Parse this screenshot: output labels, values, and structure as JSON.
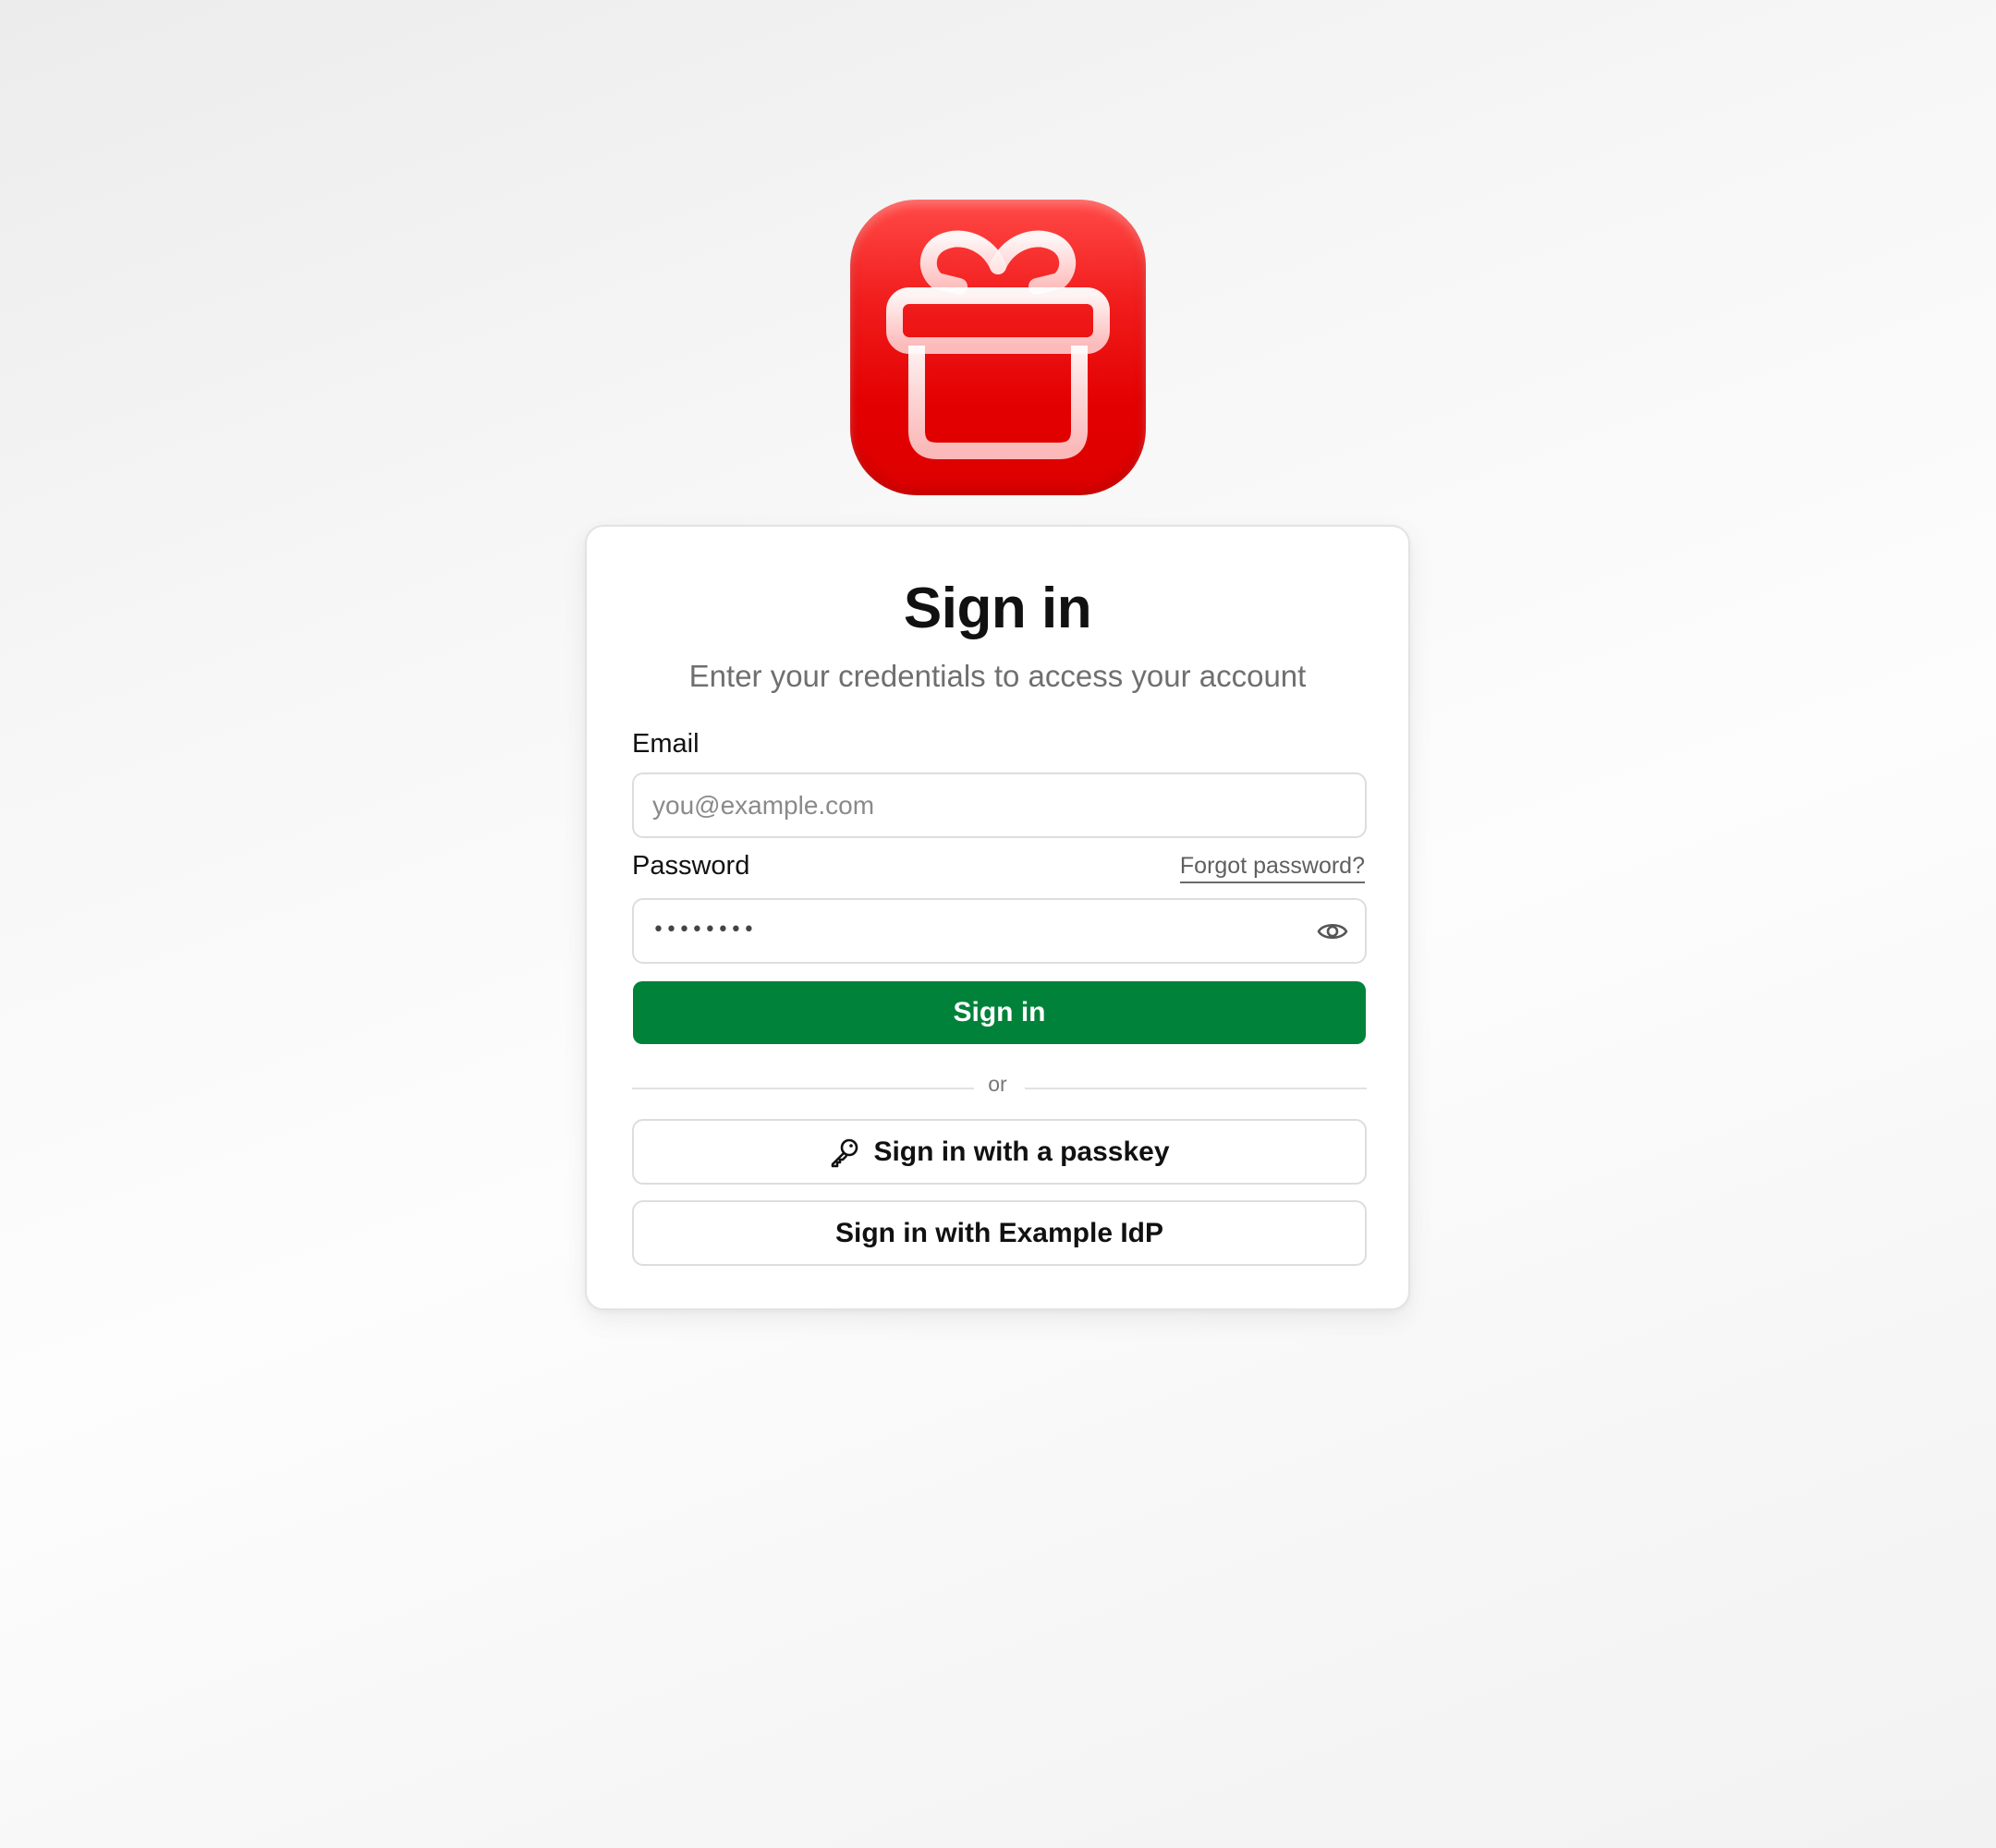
{
  "brand": {
    "logo_icon": "gift-icon",
    "logo_colors": {
      "top": "#ff4a47",
      "bottom": "#dd0000"
    }
  },
  "signin": {
    "title": "Sign in",
    "subtitle": "Enter your credentials to access your account",
    "email": {
      "label": "Email",
      "placeholder": "you@example.com",
      "value": ""
    },
    "password": {
      "label": "Password",
      "masked_value": "••••••••",
      "forgot_link": "Forgot password?",
      "toggle_icon": "eye-icon"
    },
    "submit_label": "Sign in",
    "divider_text": "or",
    "passkey_label": "Sign in with a passkey",
    "passkey_icon": "key-icon",
    "idp_label": "Sign in with Example IdP"
  },
  "colors": {
    "primary": "#00823a",
    "text": "#111111",
    "muted": "#6f6f6f",
    "border": "#dddddd"
  }
}
